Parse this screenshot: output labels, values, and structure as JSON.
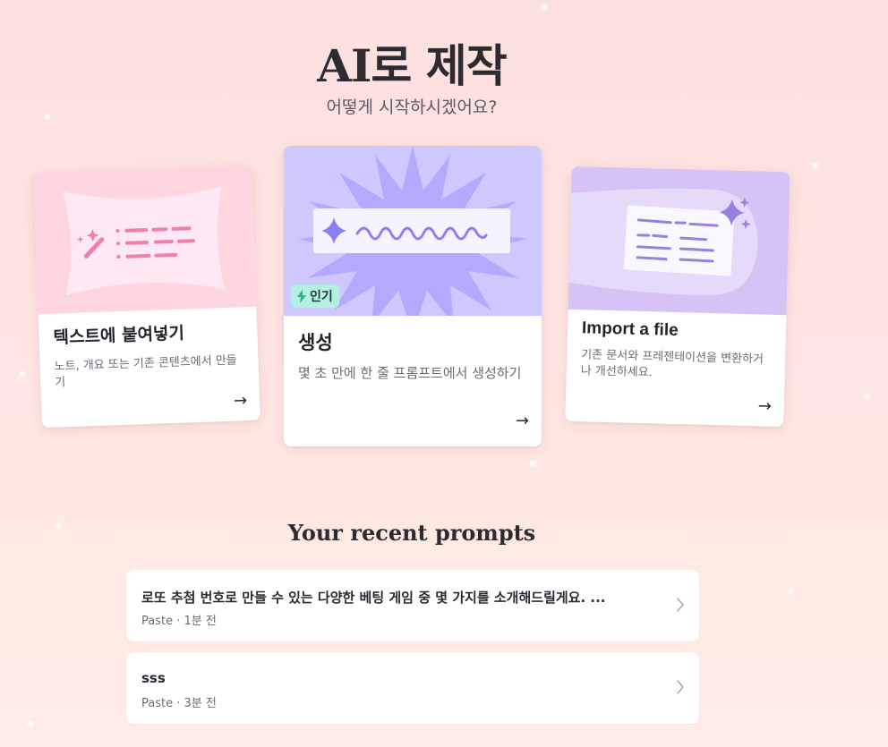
{
  "header": {
    "title": "AI로 제작",
    "subtitle": "어떻게 시작하시겠어요?"
  },
  "cards": [
    {
      "title": "텍스트에 붙여넣기",
      "description": "노트, 개요 또는 기존 콘텐츠에서 만들기",
      "arrow": "→"
    },
    {
      "title": "생성",
      "description": "몇 초 만에 한 줄 프롬프트에서 생성하기",
      "badge": "인기",
      "arrow": "→"
    },
    {
      "title": "Import a file",
      "description": "기존 문서와 프레젠테이션을 변환하거나 개선하세요.",
      "arrow": "→"
    }
  ],
  "recent": {
    "heading": "Your recent prompts",
    "items": [
      {
        "title": "로또 추첨 번호로 만들 수 있는 다양한 베팅 게임 중 몇 가지를 소개해드릴게요. ...",
        "meta": "Paste · 1분 전"
      },
      {
        "title": "sss",
        "meta": "Paste · 3분 전"
      }
    ]
  },
  "icons": {
    "card_arrow": "arrow-right-icon",
    "item_chevron": "chevron-right-icon",
    "badge_icon": "lightning-icon"
  },
  "colors": {
    "background_top": "#fde0e0",
    "card_paste_art": "#ffd6e0",
    "card_generate_art": "#cfc8ff",
    "card_import_art": "#d6c2f5",
    "badge_bg": "#b3f0e2"
  }
}
